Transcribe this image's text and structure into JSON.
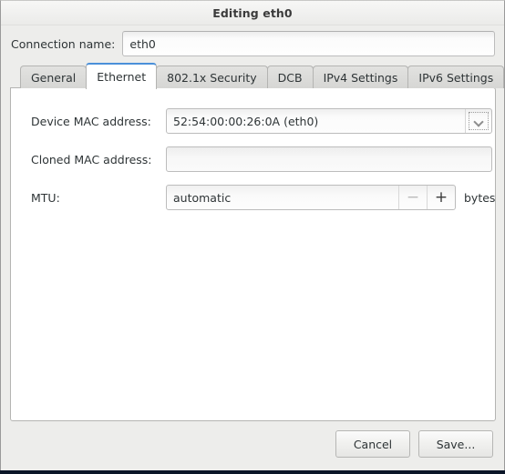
{
  "window": {
    "title": "Editing eth0"
  },
  "connection": {
    "label": "Connection name:",
    "value": "eth0",
    "placeholder": ""
  },
  "tabs": [
    {
      "label": "General",
      "active": false
    },
    {
      "label": "Ethernet",
      "active": true
    },
    {
      "label": "802.1x Security",
      "active": false
    },
    {
      "label": "DCB",
      "active": false
    },
    {
      "label": "IPv4 Settings",
      "active": false
    },
    {
      "label": "IPv6 Settings",
      "active": false
    }
  ],
  "ethernet": {
    "device_mac": {
      "label": "Device MAC address:",
      "value": "52:54:00:00:26:0A (eth0)",
      "arrow_icon": "chevron-down-icon"
    },
    "cloned_mac": {
      "label": "Cloned MAC address:",
      "value": "",
      "placeholder": ""
    },
    "mtu": {
      "label": "MTU:",
      "value": "automatic",
      "decrement": "−",
      "increment": "+",
      "unit": "bytes"
    }
  },
  "actions": {
    "cancel": "Cancel",
    "save": "Save..."
  },
  "colors": {
    "accent": "#4a90d9",
    "window_bg": "#ededeb",
    "panel_bg": "#ffffff",
    "text": "#2e3436"
  }
}
